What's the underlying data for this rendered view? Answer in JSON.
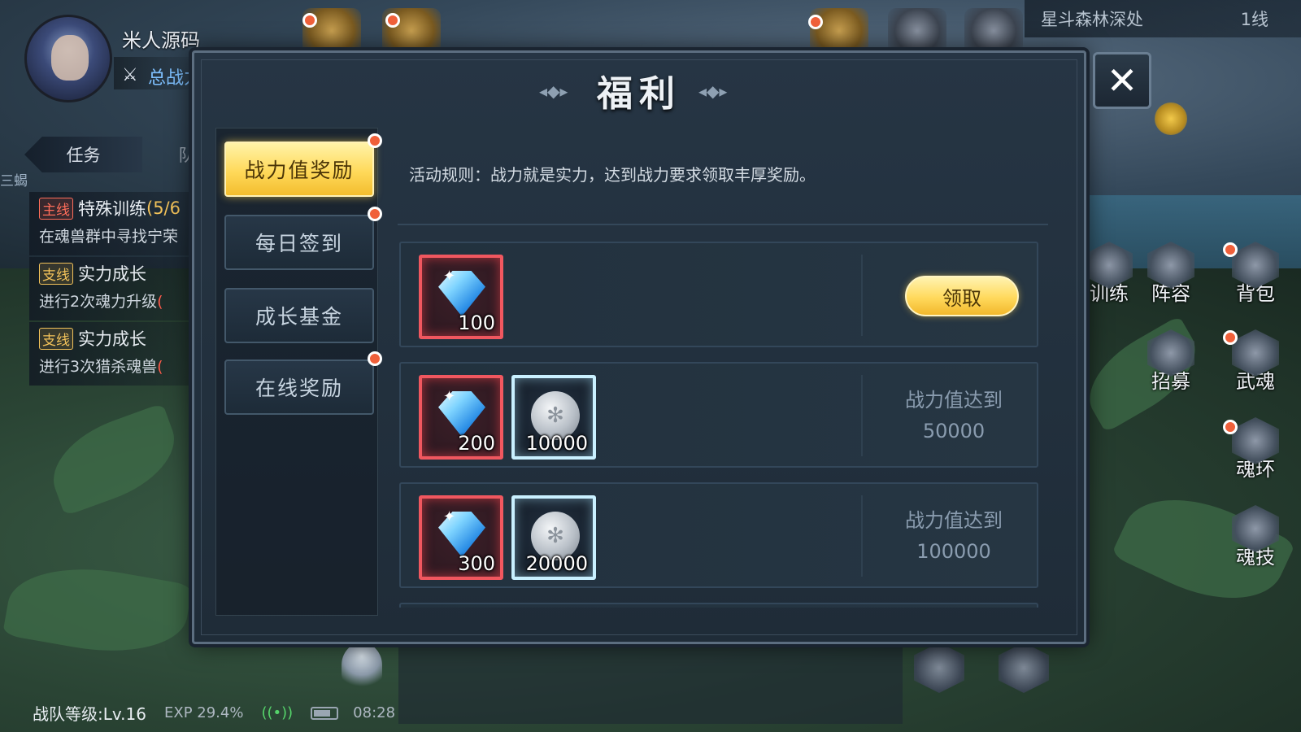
{
  "player": {
    "name": "米人源码",
    "power_label": "总战力"
  },
  "location": {
    "name": "星斗森林深处",
    "line": "1线"
  },
  "task_panel": {
    "tab_active": "任务",
    "tab_other": "队",
    "edge_label": "三蝎",
    "tasks": [
      {
        "tag": "主线",
        "title": "特殊训练",
        "progress": "(5/6",
        "desc": "在魂兽群中寻找宁荣",
        "desc_extra": ""
      },
      {
        "tag": "支线",
        "title": "实力成长",
        "progress": "",
        "desc": "进行2次魂力升级",
        "desc_extra": "("
      },
      {
        "tag": "支线",
        "title": "实力成长",
        "progress": "",
        "desc": "进行3次猎杀魂兽",
        "desc_extra": "("
      }
    ]
  },
  "side_menu": {
    "training": "训练",
    "lineup": "阵容",
    "bag": "背包",
    "recruit": "招募",
    "martial_soul": "武魂",
    "soul_ring": "魂环",
    "soul_skill": "魂技"
  },
  "status_bar": {
    "team_level": "战队等级:Lv.16",
    "exp": "EXP 29.4%",
    "time": "08:28"
  },
  "dialog": {
    "title": "福利",
    "close_symbol": "✕",
    "nav": [
      {
        "label": "战力值奖励",
        "active": true,
        "red_dot": true
      },
      {
        "label": "每日签到",
        "active": false,
        "red_dot": true
      },
      {
        "label": "成长基金",
        "active": false,
        "red_dot": false
      },
      {
        "label": "在线奖励",
        "active": false,
        "red_dot": true
      }
    ],
    "rule": "活动规则：战力就是实力，达到战力要求领取丰厚奖励。",
    "rewards": [
      {
        "items": [
          {
            "type": "diamond",
            "qty": "100"
          }
        ],
        "action": "领取",
        "requirement_label": "",
        "requirement_value": ""
      },
      {
        "items": [
          {
            "type": "diamond",
            "qty": "200"
          },
          {
            "type": "coin",
            "qty": "10000"
          }
        ],
        "action": "",
        "requirement_label": "战力值达到",
        "requirement_value": "50000"
      },
      {
        "items": [
          {
            "type": "diamond",
            "qty": "300"
          },
          {
            "type": "coin",
            "qty": "20000"
          }
        ],
        "action": "",
        "requirement_label": "战力值达到",
        "requirement_value": "100000"
      }
    ]
  },
  "colors": {
    "accent_gold": "#ffd95a",
    "red_dot": "#f0603a",
    "diamond_border": "#f0575f",
    "coin_border": "#c9f0ff"
  },
  "icons": {
    "power": "crossed-swords-icon",
    "diamond": "diamond-icon",
    "coin": "silver-coin-icon",
    "close": "close-icon",
    "wifi": "wifi-icon",
    "battery": "battery-icon"
  }
}
